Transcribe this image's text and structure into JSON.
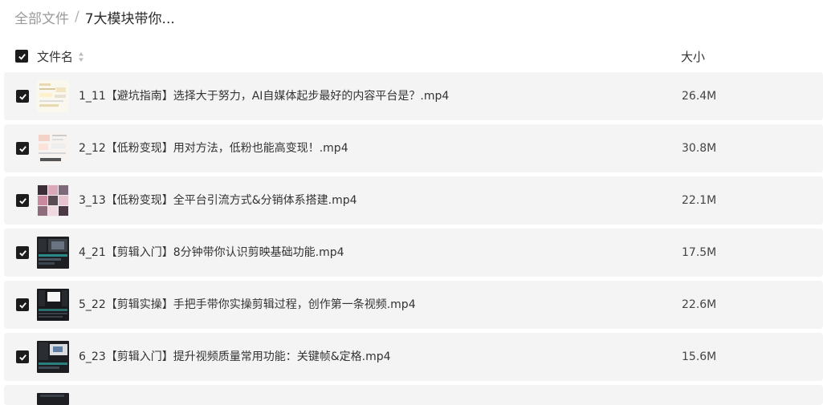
{
  "breadcrumb": {
    "root": "全部文件",
    "separator": "/",
    "current": "7大模块带你..."
  },
  "header": {
    "name_label": "文件名",
    "size_label": "大小",
    "sort_icon": "sort-updown-icon"
  },
  "files": [
    {
      "name": "1_11【避坑指南】选择大于努力，AI自媒体起步最好的内容平台是？.mp4",
      "size": "26.4M",
      "checked": true
    },
    {
      "name": "2_12【低粉变现】用对方法，低粉也能高变现！.mp4",
      "size": "30.8M",
      "checked": true
    },
    {
      "name": "3_13【低粉变现】全平台引流方式&分销体系搭建.mp4",
      "size": "22.1M",
      "checked": true
    },
    {
      "name": "4_21【剪辑入门】8分钟带你认识剪映基础功能.mp4",
      "size": "17.5M",
      "checked": true
    },
    {
      "name": "5_22【剪辑实操】手把手带你实操剪辑过程，创作第一条视频.mp4",
      "size": "22.6M",
      "checked": true
    },
    {
      "name": "6_23【剪辑入门】提升视频质量常用功能：关键帧&定格.mp4",
      "size": "15.6M",
      "checked": true
    }
  ],
  "colors": {
    "row_bg": "#f4f4f5",
    "checkbox": "#1c1c1c"
  }
}
